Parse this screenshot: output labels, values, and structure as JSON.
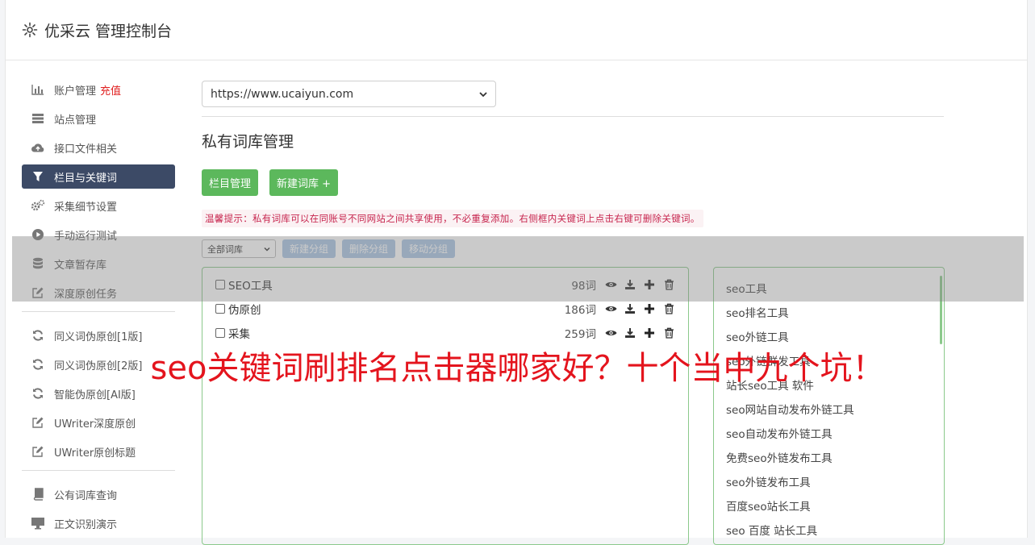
{
  "header": {
    "title": "优采云 管理控制台"
  },
  "sidebar": {
    "group1": [
      {
        "label": "账户管理",
        "extra": "充值",
        "icon": "bar-chart-icon"
      },
      {
        "label": "站点管理",
        "icon": "server-icon"
      },
      {
        "label": "接口文件相关",
        "icon": "cloud-upload-icon"
      },
      {
        "label": "栏目与关键词",
        "icon": "filter-icon",
        "active": true
      },
      {
        "label": "采集细节设置",
        "icon": "gears-icon"
      },
      {
        "label": "手动运行测试",
        "icon": "play-circle-icon"
      },
      {
        "label": "文章暂存库",
        "icon": "database-icon"
      },
      {
        "label": "深度原创任务",
        "icon": "edit-icon"
      }
    ],
    "group2": [
      {
        "label": "同义词伪原创[1版]",
        "icon": "refresh-icon"
      },
      {
        "label": "同义词伪原创[2版]",
        "icon": "refresh-icon"
      },
      {
        "label": "智能伪原创[AI版]",
        "icon": "refresh-icon"
      },
      {
        "label": "UWriter深度原创",
        "icon": "edit-icon"
      },
      {
        "label": "UWriter原创标题",
        "icon": "edit-icon"
      }
    ],
    "group3": [
      {
        "label": "公有词库查询",
        "icon": "book-icon"
      },
      {
        "label": "正文识别演示",
        "icon": "monitor-icon"
      }
    ]
  },
  "main": {
    "site_select": "https://www.ucaiyun.com",
    "section_title": "私有词库管理",
    "btn_columns": "栏目管理",
    "btn_new_lib": "新建词库 +",
    "tip": "温馨提示：私有词库可以在同账号不同网站之间共享使用，不必重复添加。右侧框内关键词上点击右键可删除关键词。",
    "lib_filter": "全部词库",
    "btn_new_group": "新建分组",
    "btn_delete_group": "删除分组",
    "btn_move_group": "移动分组",
    "libraries": [
      {
        "name": "SEO工具",
        "count": "98词"
      },
      {
        "name": "伪原创",
        "count": "186词"
      },
      {
        "name": "采集",
        "count": "259词"
      }
    ],
    "keywords": [
      "seo工具",
      "seo排名工具",
      "seo外链工具",
      "seo外链群发工具",
      "站长seo工具 软件",
      "seo网站自动发布外链工具",
      "seo自动发布外链工具",
      "免费seo外链发布工具",
      "seo外链发布工具",
      "百度seo站长工具",
      "seo 百度 站长工具"
    ]
  },
  "caption": "seo关键词刷排名点击器哪家好？十个当中九个坑！",
  "colors": {
    "accent_green": "#5cb85c",
    "active_nav": "#3c4a66",
    "caption_red": "#e4141d",
    "tip_red": "#c7254e"
  }
}
